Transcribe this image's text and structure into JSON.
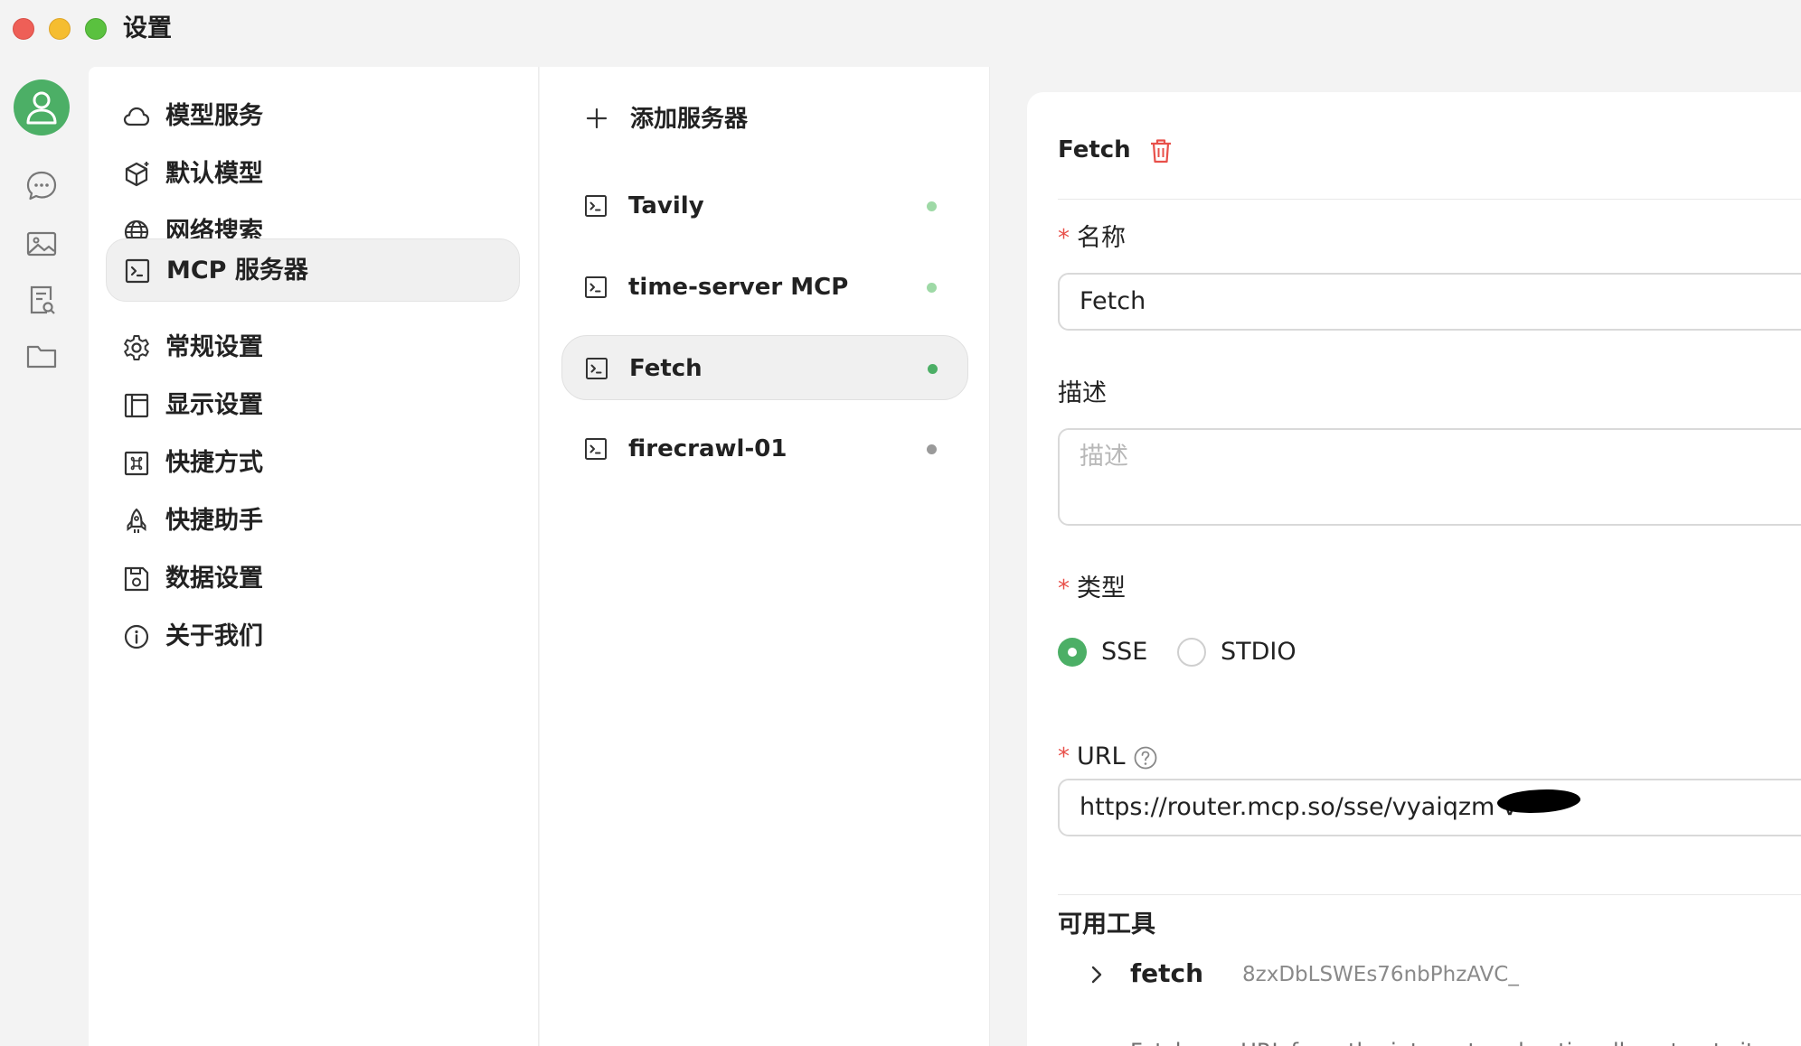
{
  "window": {
    "title": "设置"
  },
  "settings_nav": {
    "items": [
      {
        "label": "模型服务",
        "icon": "cloud-icon"
      },
      {
        "label": "默认模型",
        "icon": "cube-icon"
      },
      {
        "label": "网络搜索",
        "icon": "globe-icon"
      },
      {
        "label": "MCP 服务器",
        "icon": "terminal-icon",
        "active": true
      },
      {
        "label": "常规设置",
        "icon": "gear-icon"
      },
      {
        "label": "显示设置",
        "icon": "layout-icon"
      },
      {
        "label": "快捷方式",
        "icon": "command-icon"
      },
      {
        "label": "快捷助手",
        "icon": "rocket-icon"
      },
      {
        "label": "数据设置",
        "icon": "save-icon"
      },
      {
        "label": "关于我们",
        "icon": "info-icon"
      }
    ]
  },
  "server_list": {
    "add_label": "添加服务器",
    "servers": [
      {
        "name": "Tavily",
        "status_color": "#9ed9a6"
      },
      {
        "name": "time-server MCP",
        "status_color": "#9ed9a6"
      },
      {
        "name": "Fetch",
        "status_color": "#4caf66",
        "active": true
      },
      {
        "name": "firecrawl-01",
        "status_color": "#9a9a9a"
      }
    ]
  },
  "detail": {
    "title": "Fetch",
    "name_label": "名称",
    "name_value": "Fetch",
    "desc_label": "描述",
    "desc_placeholder": "描述",
    "type_label": "类型",
    "type_options": [
      "SSE",
      "STDIO"
    ],
    "type_selected": "SSE",
    "url_label": "URL",
    "url_value": "https://router.mcp.so/sse/vyaiqzm      v",
    "tools_title": "可用工具",
    "tool": {
      "name": "fetch",
      "id": "8zxDbLSWEs76nbPhzAVC_",
      "description": "Fetches a URL from the internet and optionally extracts it"
    }
  },
  "colors": {
    "accent": "#4caf66",
    "required": "#e8504a",
    "danger": "#e8504a"
  }
}
